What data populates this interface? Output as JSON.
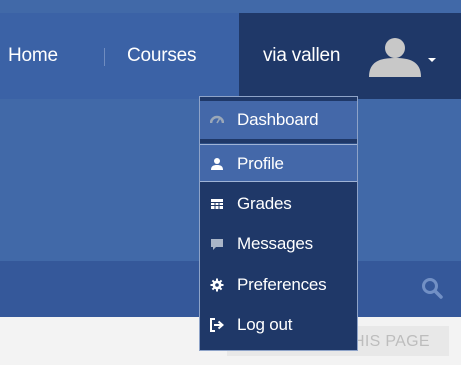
{
  "nav": {
    "home_label": "Home",
    "courses_label": "Courses"
  },
  "user": {
    "name": "via vallen",
    "avatar_icon": "user-avatar-icon",
    "menu_icon": "caret-down-icon"
  },
  "user_menu": {
    "items": [
      {
        "label": "Dashboard",
        "icon": "dashboard-icon"
      },
      {
        "label": "Profile",
        "icon": "user-icon",
        "highlighted": true
      },
      {
        "label": "Grades",
        "icon": "table-icon"
      },
      {
        "label": "Messages",
        "icon": "comment-icon"
      },
      {
        "label": "Preferences",
        "icon": "gear-icon"
      },
      {
        "label": "Log out",
        "icon": "sign-out-icon"
      }
    ]
  },
  "page": {
    "customise_label": "CUSTOMISE THIS PAGE",
    "search_icon": "search-icon"
  },
  "colors": {
    "nav_bg": "#3b62a6",
    "dark_navy": "#1f3868",
    "highlight": "#4468a9"
  }
}
